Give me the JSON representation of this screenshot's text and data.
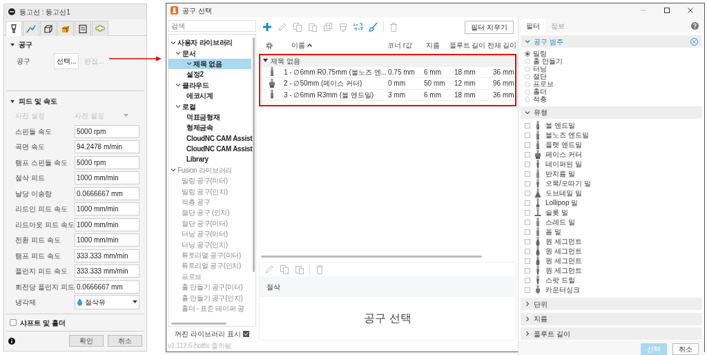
{
  "panel": {
    "title": "등고선 : 등고선1",
    "tabs": [
      {
        "kind": "tool",
        "selected": true
      },
      {
        "kind": "geometry",
        "selected": false
      },
      {
        "kind": "heights",
        "selected": false
      },
      {
        "kind": "passes",
        "selected": false
      },
      {
        "kind": "linking",
        "selected": false
      },
      {
        "kind": "shape",
        "selected": false
      }
    ],
    "tool_section": {
      "title": "공구",
      "expanded": true,
      "label": "공구",
      "select_button": "선택...",
      "edit_button": {
        "label": "편집...",
        "disabled": true
      }
    },
    "feed_section": {
      "title": "피드 및 속도",
      "expanded": true,
      "preset": {
        "label": "사전 설정",
        "value": "사전 설정",
        "disabled": true
      },
      "fields": [
        {
          "label": "스핀들 속도",
          "value": "5000 rpm"
        },
        {
          "label": "곡면 속도",
          "value": "94.2478 m/min"
        },
        {
          "label": "램프 스핀들 속도",
          "value": "5000 rpm"
        },
        {
          "label": "절삭 피드",
          "value": "1000 mm/min"
        },
        {
          "label": "날당 이송량",
          "value": "0.0666667 mm"
        },
        {
          "label": "리드인 피드 속도",
          "value": "1000 mm/min"
        },
        {
          "label": "리드아웃 피드 속도",
          "value": "1000 mm/min"
        },
        {
          "label": "전환 피드 속도",
          "value": "1000 mm/min"
        },
        {
          "label": "램프 피드 속도",
          "value": "333.333 mm/min"
        },
        {
          "label": "플런지 피드 속도",
          "value": "333.333 mm/min"
        },
        {
          "label": "회전당 플런지 피드",
          "value": "0.0666667 mm"
        }
      ],
      "coolant": {
        "label": "냉각제",
        "value": "절삭유"
      }
    },
    "shaft_section": {
      "title": "샤프트 및 홀더",
      "checked": false
    },
    "buttons": [
      "확인",
      "취소"
    ]
  },
  "tool_dialog": {
    "title": "공구 선택",
    "search": {
      "placeholder": "검색"
    },
    "tree": [
      {
        "label": "사용자 라이브러리",
        "expanded": true,
        "selected": false,
        "muted": false,
        "children": [
          {
            "label": "문서",
            "expanded": true,
            "selected": false,
            "muted": false,
            "children": [
              {
                "label": "제목 없음",
                "expanded": true,
                "selected": true,
                "muted": false
              },
              {
                "label": "설정2",
                "selected": false,
                "muted": false
              }
            ]
          },
          {
            "label": "클라우드",
            "expanded": true,
            "selected": false,
            "muted": false,
            "children": [
              {
                "label": "에코시계",
                "selected": false,
                "muted": false
              }
            ]
          },
          {
            "label": "로컬",
            "expanded": true,
            "selected": false,
            "muted": false,
            "children": [
              {
                "label": "덕표금형재",
                "selected": false,
                "muted": false
              },
              {
                "label": "형제금속",
                "selected": false,
                "muted": false
              },
              {
                "label": "CloudNC CAM Assist",
                "selected": false,
                "muted": false
              },
              {
                "label": "CloudNC CAM Assist",
                "selected": false,
                "muted": false
              },
              {
                "label": "Library",
                "selected": false,
                "muted": false
              }
            ]
          }
        ]
      },
      {
        "label": "Fusion 라이브러리",
        "expanded": true,
        "selected": false,
        "muted": true,
        "children": [
          {
            "label": "밀링 공구(미터)",
            "selected": false,
            "muted": true
          },
          {
            "label": "밀링 공구(인치)",
            "selected": false,
            "muted": true
          },
          {
            "label": "적층 공구",
            "selected": false,
            "muted": true
          },
          {
            "label": "절단 공구 (인치)",
            "selected": false,
            "muted": true
          },
          {
            "label": "절단 공구(미터)",
            "selected": false,
            "muted": true
          },
          {
            "label": "터닝 공구(미터)",
            "selected": false,
            "muted": true
          },
          {
            "label": "터닝 공구(인치)",
            "selected": false,
            "muted": true
          },
          {
            "label": "튜토리얼 공구(미터)",
            "selected": false,
            "muted": true
          },
          {
            "label": "튜토리얼 공구(인치)",
            "selected": false,
            "muted": true
          },
          {
            "label": "프로브",
            "selected": false,
            "muted": true
          },
          {
            "label": "홀 만들기 공구(미터)",
            "selected": false,
            "muted": true
          },
          {
            "label": "홀 만들기 공구(인치)",
            "selected": false,
            "muted": true
          },
          {
            "label": "홀더 - 표준 테이퍼 공",
            "selected": false,
            "muted": true
          }
        ]
      }
    ],
    "show_hidden": {
      "label": "꺼진 라이브러리 표시",
      "checked": true
    },
    "version": "v1.112.6-hotfix 출하됨",
    "toolbar": [
      {
        "kind": "add",
        "disabled": false
      },
      {
        "kind": "edit",
        "disabled": true
      },
      {
        "kind": "copy",
        "disabled": true
      },
      {
        "kind": "paste",
        "disabled": true
      },
      {
        "kind": "duplicate",
        "disabled": true
      },
      {
        "kind": "holder",
        "disabled": true
      },
      {
        "kind": "renumber",
        "disabled": false
      },
      {
        "kind": "brush",
        "disabled": false
      },
      {
        "kind": "delete",
        "disabled": true
      }
    ],
    "clear_filter_button": "필터 지우기",
    "table": {
      "columns": [
        "이름",
        "코너 r값",
        "지름",
        "플루트 길이",
        "전체 길이"
      ],
      "group": {
        "label": "제목 없음",
        "expanded": true
      },
      "rows": [
        {
          "kind": "bullnose",
          "cells": [
            "1 - ∅6mm R0.75mm (볼노즈 엔...",
            "0.75 mm",
            "6 mm",
            "18 mm",
            "36 mm"
          ]
        },
        {
          "kind": "face",
          "cells": [
            "2 - ∅50mm (페이스 커터)",
            "0 mm",
            "50 mm",
            "12 mm",
            "96 mm"
          ]
        },
        {
          "kind": "ball",
          "cells": [
            "3 - ∅6mm R3mm (볼 엔드밀)",
            "3 mm",
            "6 mm",
            "18 mm",
            "36 mm"
          ]
        }
      ]
    },
    "lower_toolbar": [
      {
        "kind": "edit",
        "disabled": true
      },
      {
        "kind": "copy",
        "disabled": true
      },
      {
        "kind": "paste",
        "disabled": true
      },
      {
        "kind": "delete",
        "disabled": true
      }
    ],
    "detail": {
      "section": "절삭",
      "placeholder": "공구 선택"
    },
    "filter_tabs": [
      {
        "label": "필터",
        "selected": true
      },
      {
        "label": "정보",
        "selected": false
      }
    ],
    "category": {
      "title": "공구 범주",
      "expanded": true,
      "options": [
        {
          "label": "밀링",
          "selected": true
        },
        {
          "label": "홀 만들기",
          "selected": false
        },
        {
          "label": "터닝",
          "selected": false
        },
        {
          "label": "절단",
          "selected": false
        },
        {
          "label": "프로브",
          "selected": false
        },
        {
          "label": "홀더",
          "selected": false
        },
        {
          "label": "적층",
          "selected": false
        }
      ]
    },
    "type": {
      "title": "유형",
      "expanded": true,
      "items": [
        {
          "label": "볼 엔드밀",
          "kind": "ball",
          "checked": false
        },
        {
          "label": "볼노즈 엔드밀",
          "kind": "bullnose",
          "checked": false
        },
        {
          "label": "플랫 엔드밀",
          "kind": "flat",
          "checked": false
        },
        {
          "label": "페이스 커터",
          "kind": "face",
          "checked": false
        },
        {
          "label": "테이퍼된 밀",
          "kind": "taper",
          "checked": false
        },
        {
          "label": "반지름 밀",
          "kind": "radius",
          "checked": false
        },
        {
          "label": "오목/모따기 밀",
          "kind": "chamfer",
          "checked": false
        },
        {
          "label": "도브테일 밀",
          "kind": "dovetail",
          "checked": false
        },
        {
          "label": "Lollipop 밀",
          "kind": "lollipop",
          "checked": false
        },
        {
          "label": "슬롯 밀",
          "kind": "slot",
          "checked": false
        },
        {
          "label": "스레드 밀",
          "kind": "thread",
          "checked": false
        },
        {
          "label": "폼 밀",
          "kind": "form",
          "checked": false
        },
        {
          "label": "원 세그먼트",
          "kind": "barrel",
          "checked": false
        },
        {
          "label": "원 세그먼트",
          "kind": "lens",
          "checked": false
        },
        {
          "label": "원 세그먼트",
          "kind": "oval",
          "checked": false
        },
        {
          "label": "원 세그먼트",
          "kind": "tapered",
          "checked": false
        },
        {
          "label": "스팟 드릴",
          "kind": "spot",
          "checked": false
        },
        {
          "label": "카운터싱크",
          "kind": "countersink",
          "checked": false
        }
      ]
    },
    "collapsed_sections": [
      {
        "title": "단위",
        "expanded": false
      },
      {
        "title": "지름",
        "expanded": false
      },
      {
        "title": "플루트 길이",
        "expanded": false
      }
    ],
    "buttons": [
      {
        "label": "선택",
        "disabled": true
      },
      {
        "label": "취소",
        "disabled": false
      }
    ]
  }
}
